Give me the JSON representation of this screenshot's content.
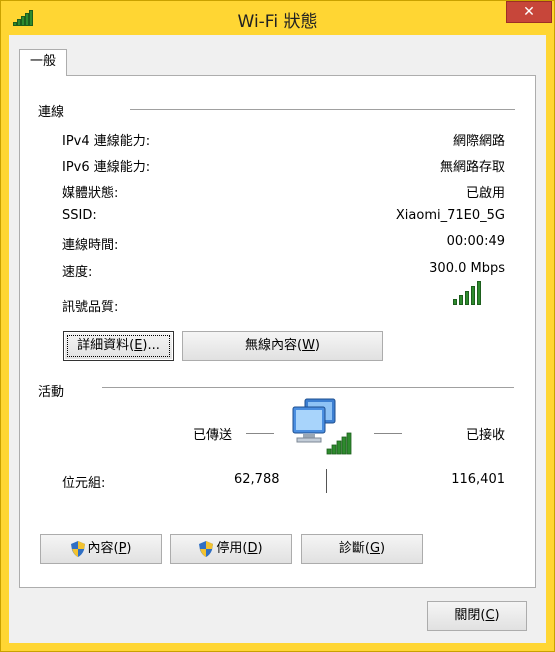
{
  "window": {
    "title": "Wi-Fi 狀態",
    "close_label": "✕"
  },
  "tab": {
    "label": "一般"
  },
  "connection": {
    "heading": "連線",
    "rows": [
      {
        "label": "IPv4 連線能力:",
        "value": "網際網路"
      },
      {
        "label": "IPv6 連線能力:",
        "value": "無網路存取"
      },
      {
        "label": "媒體狀態:",
        "value": "已啟用"
      },
      {
        "label": "SSID:",
        "value": "Xiaomi_71E0_5G"
      },
      {
        "label": "連線時間:",
        "value": "00:00:49"
      },
      {
        "label": "速度:",
        "value": "300.0 Mbps"
      },
      {
        "label": "訊號品質:",
        "value": ""
      }
    ],
    "signal_level": "5/5",
    "details_button": {
      "text": "詳細資料(",
      "key": "E",
      "tail": ")..."
    },
    "wireless_button": {
      "text": "無線內容(",
      "key": "W",
      "tail": ")"
    }
  },
  "activity": {
    "heading": "活動",
    "sent_label": "已傳送",
    "received_label": "已接收",
    "bytes_label": "位元組:",
    "bytes_sent": "62,788",
    "bytes_received": "116,401"
  },
  "bottom_buttons": {
    "properties": {
      "text": "內容(",
      "key": "P",
      "tail": ")"
    },
    "disable": {
      "text": "停用(",
      "key": "D",
      "tail": ")"
    },
    "diagnose": {
      "text": "診斷(",
      "key": "G",
      "tail": ")"
    }
  },
  "footer": {
    "close_button": {
      "text": "關閉(",
      "key": "C",
      "tail": ")"
    }
  },
  "colors": {
    "frame": "#ffd633",
    "close": "#c7463a",
    "signal": "#2e8b2e"
  },
  "icons": [
    "wifi-signal-icon",
    "network-computers-icon",
    "uac-shield-icon"
  ]
}
